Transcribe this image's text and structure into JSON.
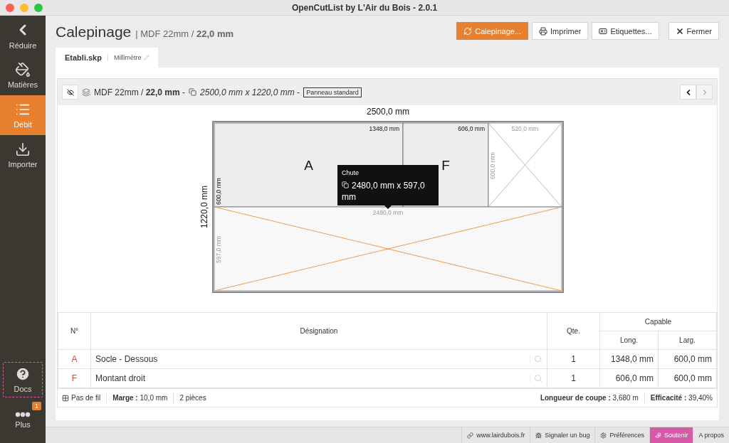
{
  "window": {
    "title": "OpenCutList by L'Air du Bois - 2.0.1"
  },
  "sidebar": {
    "items": [
      {
        "label": "Réduire",
        "selected": false
      },
      {
        "label": "Matières",
        "selected": false
      },
      {
        "label": "Débit",
        "selected": true
      },
      {
        "label": "Importer",
        "selected": false
      }
    ],
    "bottom_items": [
      {
        "label": "Docs",
        "focused": true
      },
      {
        "label": "Plus",
        "focused": false,
        "badge": "1"
      }
    ]
  },
  "header": {
    "title": "Calepinage",
    "subtitle": "| MDF 22mm / **22,0 mm**",
    "buttons": [
      {
        "label": "Calepinage...",
        "primary": true
      },
      {
        "label": "Imprimer",
        "primary": false
      },
      {
        "label": "Etiquettes...",
        "primary": false
      },
      {
        "label": "Fermer",
        "primary": false
      }
    ]
  },
  "tabs": [
    {
      "file": "Etabli.skp",
      "unit": "Millimètre",
      "selected": true
    }
  ],
  "toolbar": {
    "material": "MDF 22mm / **22,0 mm** -",
    "size": "*2500,0 mm x 1220,0 mm* -",
    "sheet_type": "Panneau standard"
  },
  "diagram": {
    "width_label": "2500,0 mm",
    "height_label": "1220,0 mm",
    "parts": [
      {
        "label": "A",
        "length": "1348,0 mm",
        "width": "600,0 mm"
      },
      {
        "label": "F",
        "length": "606,0 mm"
      }
    ],
    "wastes": [
      {
        "length": "520,0 mm",
        "width": "600,0 mm",
        "highlighted": false
      },
      {
        "length": "2480,0 mm",
        "width": "597,0 mm",
        "highlighted": true
      }
    ],
    "tooltip": {
      "title": "Chute",
      "text": "2480,0 mm x 597,0 mm"
    }
  },
  "table": {
    "columns": {
      "number": "N°",
      "designation": "Désignation",
      "quantity": "Qte.",
      "group": "Capable",
      "length": "Long.",
      "width": "Larg."
    },
    "rows": [
      {
        "number": "A",
        "name": "Socle - Dessous",
        "quantity": "1",
        "length": "1348,0 mm",
        "width": "600,0 mm"
      },
      {
        "number": "F",
        "name": "Montant droit",
        "quantity": "1",
        "length": "606,0 mm",
        "width": "600,0 mm"
      }
    ],
    "footer": {
      "grain": "Pas de fil",
      "margin": "**Marge :** 10,0 mm",
      "pieces": "2 pièces",
      "cut_length": "**Longueur de coupe :** 3,680 m",
      "efficiency": "**Efficacité :** 39,40%"
    }
  },
  "status_bar": [
    {
      "label": "www.lairdubois.fr",
      "kind": "link"
    },
    {
      "label": "Signaler un bug",
      "kind": "link"
    },
    {
      "label": "Préférences",
      "kind": "link"
    },
    {
      "label": "Soutenir",
      "kind": "support"
    },
    {
      "label": "A propos",
      "kind": "plain"
    }
  ]
}
